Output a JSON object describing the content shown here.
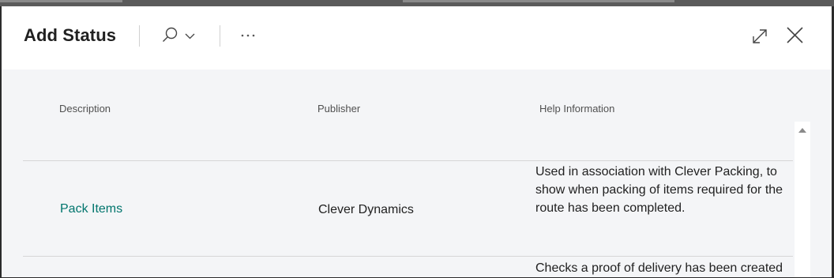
{
  "dialog": {
    "title": "Add Status"
  },
  "icons": {
    "search": "search-icon",
    "dropdown": "chevron-down-icon",
    "more": "more-options-icon",
    "expand": "expand-icon",
    "close": "close-icon",
    "scroll_up": "scroll-up-arrow-icon"
  },
  "columns": {
    "description": "Description",
    "publisher": "Publisher",
    "help": "Help Information"
  },
  "rows": [
    {
      "description": "Pack Items",
      "publisher": "Clever Dynamics",
      "help": "Used in association with Clever Packing, to show when packing of items required for the route has been completed."
    },
    {
      "description": "",
      "publisher": "",
      "help": "Checks a proof of delivery has been created"
    }
  ],
  "colors": {
    "link": "#00756d",
    "content_bg": "#f4f5f7",
    "header_bg": "#ffffff"
  }
}
